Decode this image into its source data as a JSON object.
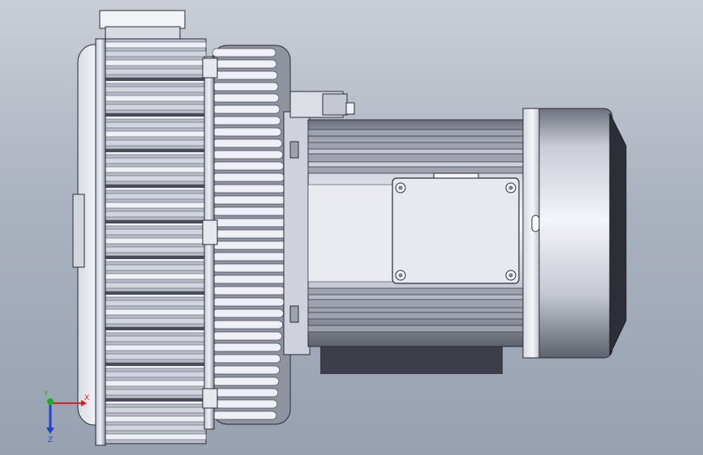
{
  "viewport": {
    "background_top": "#c9ced6",
    "background_bottom": "#97a1b0"
  },
  "model": {
    "part_colors": {
      "metal_light": "#eef0f6",
      "metal_mid": "#b9bdca",
      "metal_dark": "#4a4d58",
      "outline": "#2a2c33"
    }
  },
  "triad": {
    "x_label": "X",
    "y_label": "Y",
    "z_label": "Z",
    "x_color": "#e02020",
    "y_color": "#18b018",
    "z_color": "#2040d0"
  }
}
